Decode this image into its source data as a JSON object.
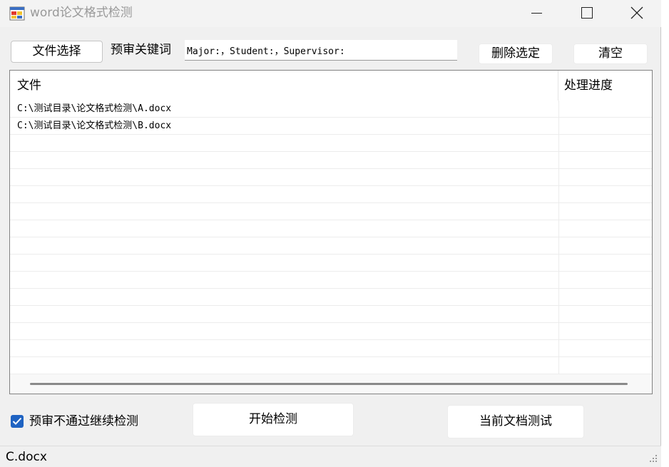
{
  "window": {
    "title": "word论文格式检测"
  },
  "toolbar": {
    "file_select_label": "文件选择",
    "prereview_keywords_label": "预审关键词",
    "keywords_value": "Major:，Student:，Supervisor:",
    "delete_selected_label": "删除选定",
    "clear_label": "清空"
  },
  "list": {
    "columns": [
      "文件",
      "处理进度"
    ],
    "rows": [
      {
        "file": "C:\\测试目录\\论文格式检测\\A.docx",
        "progress": ""
      },
      {
        "file": "C:\\测试目录\\论文格式检测\\B.docx",
        "progress": ""
      }
    ]
  },
  "options": {
    "continue_on_fail_label": "预审不通过继续检测",
    "continue_on_fail_checked": true
  },
  "actions": {
    "start_label": "开始检测",
    "test_current_label": "当前文档测试"
  },
  "status": {
    "text": "C.docx"
  },
  "icons": {
    "app": "app-icon",
    "minimize": "minimize-icon",
    "maximize": "maximize-icon",
    "close": "close-icon",
    "check": "check-icon",
    "grip": "resize-grip-icon"
  },
  "colors": {
    "checkbox": "#1f63c2",
    "window_bg": "#f0f0f0"
  }
}
